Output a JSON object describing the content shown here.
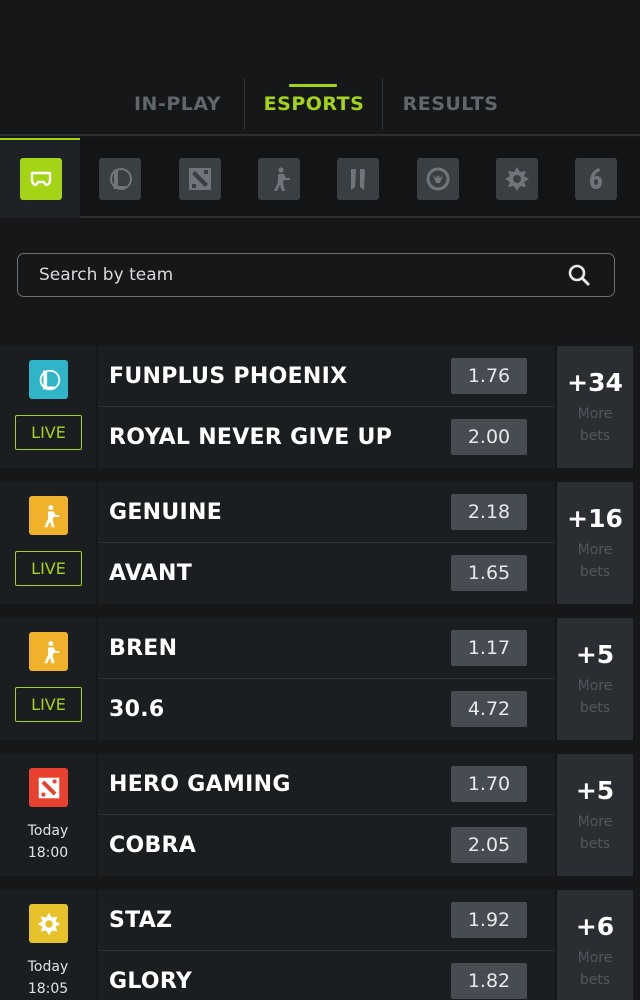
{
  "tabs": [
    {
      "label": "IN-PLAY"
    },
    {
      "label": "ESPORTS"
    },
    {
      "label": "RESULTS"
    }
  ],
  "colors": {
    "accent": "#a4d416",
    "lol": "#2fb4c8",
    "csgo": "#f0b22b",
    "dota": "#e8412f",
    "hearthstone": "#e6c12a"
  },
  "game_filters": [
    "all-games",
    "league-of-legends",
    "dota-2",
    "counter-strike",
    "smite",
    "overwatch",
    "hearthstone",
    "rainbow-six"
  ],
  "search": {
    "placeholder": "Search by team"
  },
  "matches": [
    {
      "game": "league-of-legends",
      "status": "LIVE",
      "team_a": "FUNPLUS PHOENIX",
      "odds_a": "1.76",
      "team_b": "ROYAL NEVER GIVE UP",
      "odds_b": "2.00",
      "more_count": "+34",
      "more_label_1": "More",
      "more_label_2": "bets"
    },
    {
      "game": "counter-strike",
      "status": "LIVE",
      "team_a": "GENUINE",
      "odds_a": "2.18",
      "team_b": "AVANT",
      "odds_b": "1.65",
      "more_count": "+16",
      "more_label_1": "More",
      "more_label_2": "bets"
    },
    {
      "game": "counter-strike",
      "status": "LIVE",
      "team_a": "BREN",
      "odds_a": "1.17",
      "team_b": "30.6",
      "odds_b": "4.72",
      "more_count": "+5",
      "more_label_1": "More",
      "more_label_2": "bets"
    },
    {
      "game": "dota-2",
      "day": "Today",
      "time": "18:00",
      "team_a": "HERO GAMING",
      "odds_a": "1.70",
      "team_b": "COBRA",
      "odds_b": "2.05",
      "more_count": "+5",
      "more_label_1": "More",
      "more_label_2": "bets"
    },
    {
      "game": "hearthstone",
      "day": "Today",
      "time": "18:05",
      "team_a": "STAZ",
      "odds_a": "1.92",
      "team_b": "GLORY",
      "odds_b": "1.82",
      "more_count": "+6",
      "more_label_1": "More",
      "more_label_2": "bets"
    }
  ]
}
